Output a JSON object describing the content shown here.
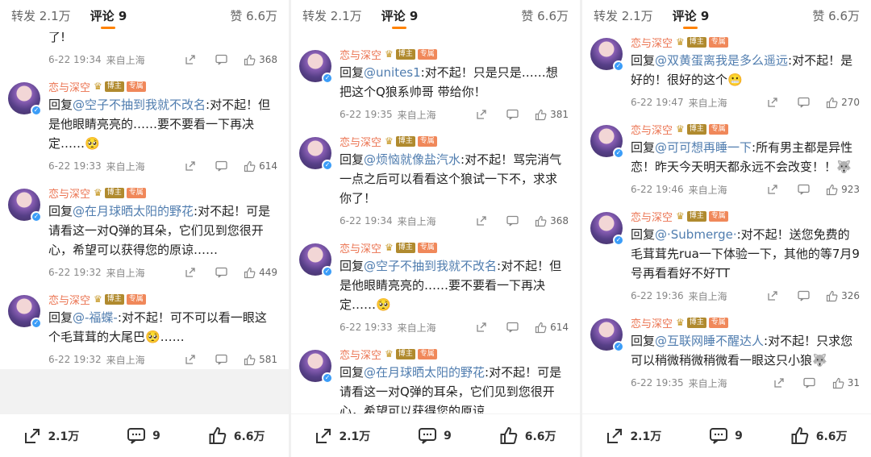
{
  "tabs": {
    "repost": "转发 2.1万",
    "comment": "评论 9",
    "like": "赞 6.6万"
  },
  "bottom": {
    "repost": "2.1万",
    "comment": "9",
    "like": "6.6万"
  },
  "common": {
    "name": "恋与深空",
    "badge1": "博主",
    "badge2": "专属",
    "location": "来自上海",
    "reply_prefix": "回复"
  },
  "colors": {
    "accent": "#ff8200",
    "name": "#eb7350",
    "mention": "#507daf"
  },
  "panels": [
    {
      "top_text": "了!",
      "top_meta": {
        "time": "6-22 19:34",
        "likes": "368"
      },
      "comments": [
        {
          "mention": "@空子不抽到我就不改名",
          "text": ":对不起！但是他眼睛亮亮的……要不要看一下再决定……🥺",
          "time": "6-22 19:33",
          "likes": "614"
        },
        {
          "mention": "@在月球晒太阳的野花",
          "text": ":对不起！可是请看这一对Q弹的耳朵，它们见到您很开心，希望可以获得您的原谅……",
          "time": "6-22 19:32",
          "likes": "449"
        },
        {
          "mention": "@-福蝶-",
          "text": ":对不起！可不可以看一眼这个毛茸茸的大尾巴🥺……",
          "time": "6-22 19:32",
          "likes": "581"
        }
      ]
    },
    {
      "comments": [
        {
          "mention": "@unites1",
          "text": ":对不起！只是只是……想把这个Q狼系帅哥 带给你！",
          "time": "6-22 19:35",
          "likes": "381"
        },
        {
          "mention": "@烦恼就像盐汽水",
          "text": ":对不起！骂完消气一点之后可以看看这个狼试一下不，求求你了！",
          "time": "6-22 19:34",
          "likes": "368"
        },
        {
          "mention": "@空子不抽到我就不改名",
          "text": ":对不起！但是他眼睛亮亮的……要不要看一下再决定……🥺",
          "time": "6-22 19:33",
          "likes": "614"
        },
        {
          "mention": "@在月球晒太阳的野花",
          "text": ":对不起！可是请看这一对Q弹的耳朵，它们见到您很开心，希望可以获得您的原谅……",
          "time": "",
          "likes": ""
        }
      ]
    },
    {
      "comments": [
        {
          "mention": "@双黄蛋离我是多么遥远",
          "text": ":对不起！是好的！很好的这个😬",
          "time": "6-22 19:47",
          "likes": "270"
        },
        {
          "mention": "@可可想再睡一下",
          "text": ":所有男主都是异性恋！昨天今天明天都永远不会改变！！🐺",
          "time": "6-22 19:46",
          "likes": "923"
        },
        {
          "mention": "@·Submerge·",
          "text": ":对不起！送您免费的毛茸茸先rua一下体验一下，其他的等7月9号再看看好不好TT",
          "time": "6-22 19:36",
          "likes": "326"
        },
        {
          "mention": "@互联网睡不醒达人",
          "text": ":对不起！只求您可以稍微稍微稍微看一眼这只小狼🐺",
          "time": "6-22 19:35",
          "likes": "31"
        }
      ]
    }
  ]
}
